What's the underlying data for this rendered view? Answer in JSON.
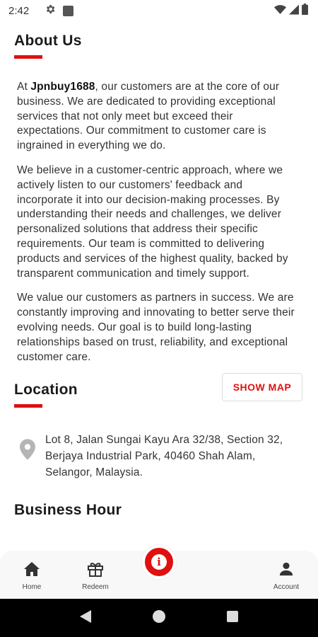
{
  "status_bar": {
    "time": "2:42"
  },
  "about": {
    "title": "About Us",
    "para1_prefix": "At ",
    "company": "Jpnbuy1688",
    "para1_suffix": ", our customers are at the core of our business. We are dedicated to providing exceptional services that not only meet but exceed their expectations. Our commitment to customer care is ingrained in everything we do.",
    "para2": "We believe in a customer-centric approach, where we actively listen to our customers' feedback and incorporate it into our decision-making processes. By understanding their needs and challenges, we deliver personalized solutions that address their specific requirements. Our team is committed to delivering products and services of the highest quality, backed by transparent communication and timely support.",
    "para3": "We value our customers as partners in success. We are constantly improving and innovating to better serve their evolving needs. Our goal is to build long-lasting relationships based on trust, reliability, and exceptional customer care."
  },
  "location": {
    "title": "Location",
    "show_map_label": "SHOW MAP",
    "address": "Lot 8, Jalan Sungai Kayu Ara 32/38, Section 32, Berjaya Industrial Park, 40460 Shah Alam, Selangor, Malaysia."
  },
  "business_hour": {
    "title": "Business Hour"
  },
  "bottom_nav": {
    "home_label": "Home",
    "redeem_label": "Redeem",
    "account_label": "Account"
  },
  "colors": {
    "accent": "#e01010"
  }
}
